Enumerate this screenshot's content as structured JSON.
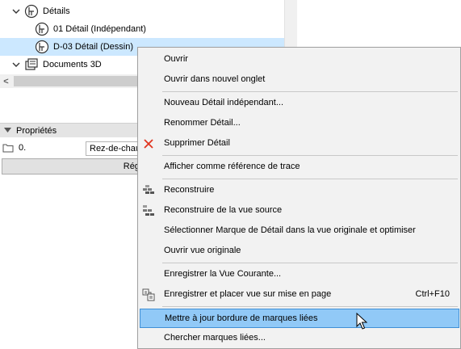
{
  "tree": {
    "items": [
      {
        "label": "Détails",
        "expanded": true,
        "icon": "detail-folder-icon"
      },
      {
        "label": "01 Détail (Indépendant)",
        "icon": "detail-icon"
      },
      {
        "label": "D-03 Détail (Dessin)",
        "icon": "detail-icon",
        "selected": true
      },
      {
        "label": "Documents 3D",
        "expanded": true,
        "icon": "document-3d-icon"
      }
    ]
  },
  "scrollbar": {
    "left_arrow": "<"
  },
  "properties": {
    "header": "Propriétés",
    "field_label": "0.",
    "field_value": "Rez-de-chaussée",
    "button_label": "Réglages"
  },
  "context_menu": {
    "items": [
      {
        "label": "Ouvrir"
      },
      {
        "label": "Ouvrir dans nouvel onglet"
      },
      {
        "label": "Nouveau Détail indépendant..."
      },
      {
        "label": "Renommer Détail..."
      },
      {
        "label": "Supprimer Détail",
        "icon": "delete-x-icon"
      },
      {
        "label": "Afficher comme référence de trace"
      },
      {
        "label": "Reconstruire",
        "icon": "rebuild-icon"
      },
      {
        "label": "Reconstruire de la vue source",
        "icon": "rebuild-source-icon"
      },
      {
        "label": "Sélectionner Marque de Détail dans la vue originale et optimiser"
      },
      {
        "label": "Ouvrir vue originale"
      },
      {
        "label": "Enregistrer la Vue Courante..."
      },
      {
        "label": "Enregistrer et placer vue sur mise en page",
        "shortcut": "Ctrl+F10",
        "icon": "save-place-icon"
      },
      {
        "label": "Mettre à jour bordure de marques liées",
        "hovered": true
      },
      {
        "label": "Chercher marques liées..."
      }
    ]
  },
  "colors": {
    "selection": "#cce8ff",
    "menu_hover": "#91c9f7",
    "delete_red": "#e0341f"
  }
}
